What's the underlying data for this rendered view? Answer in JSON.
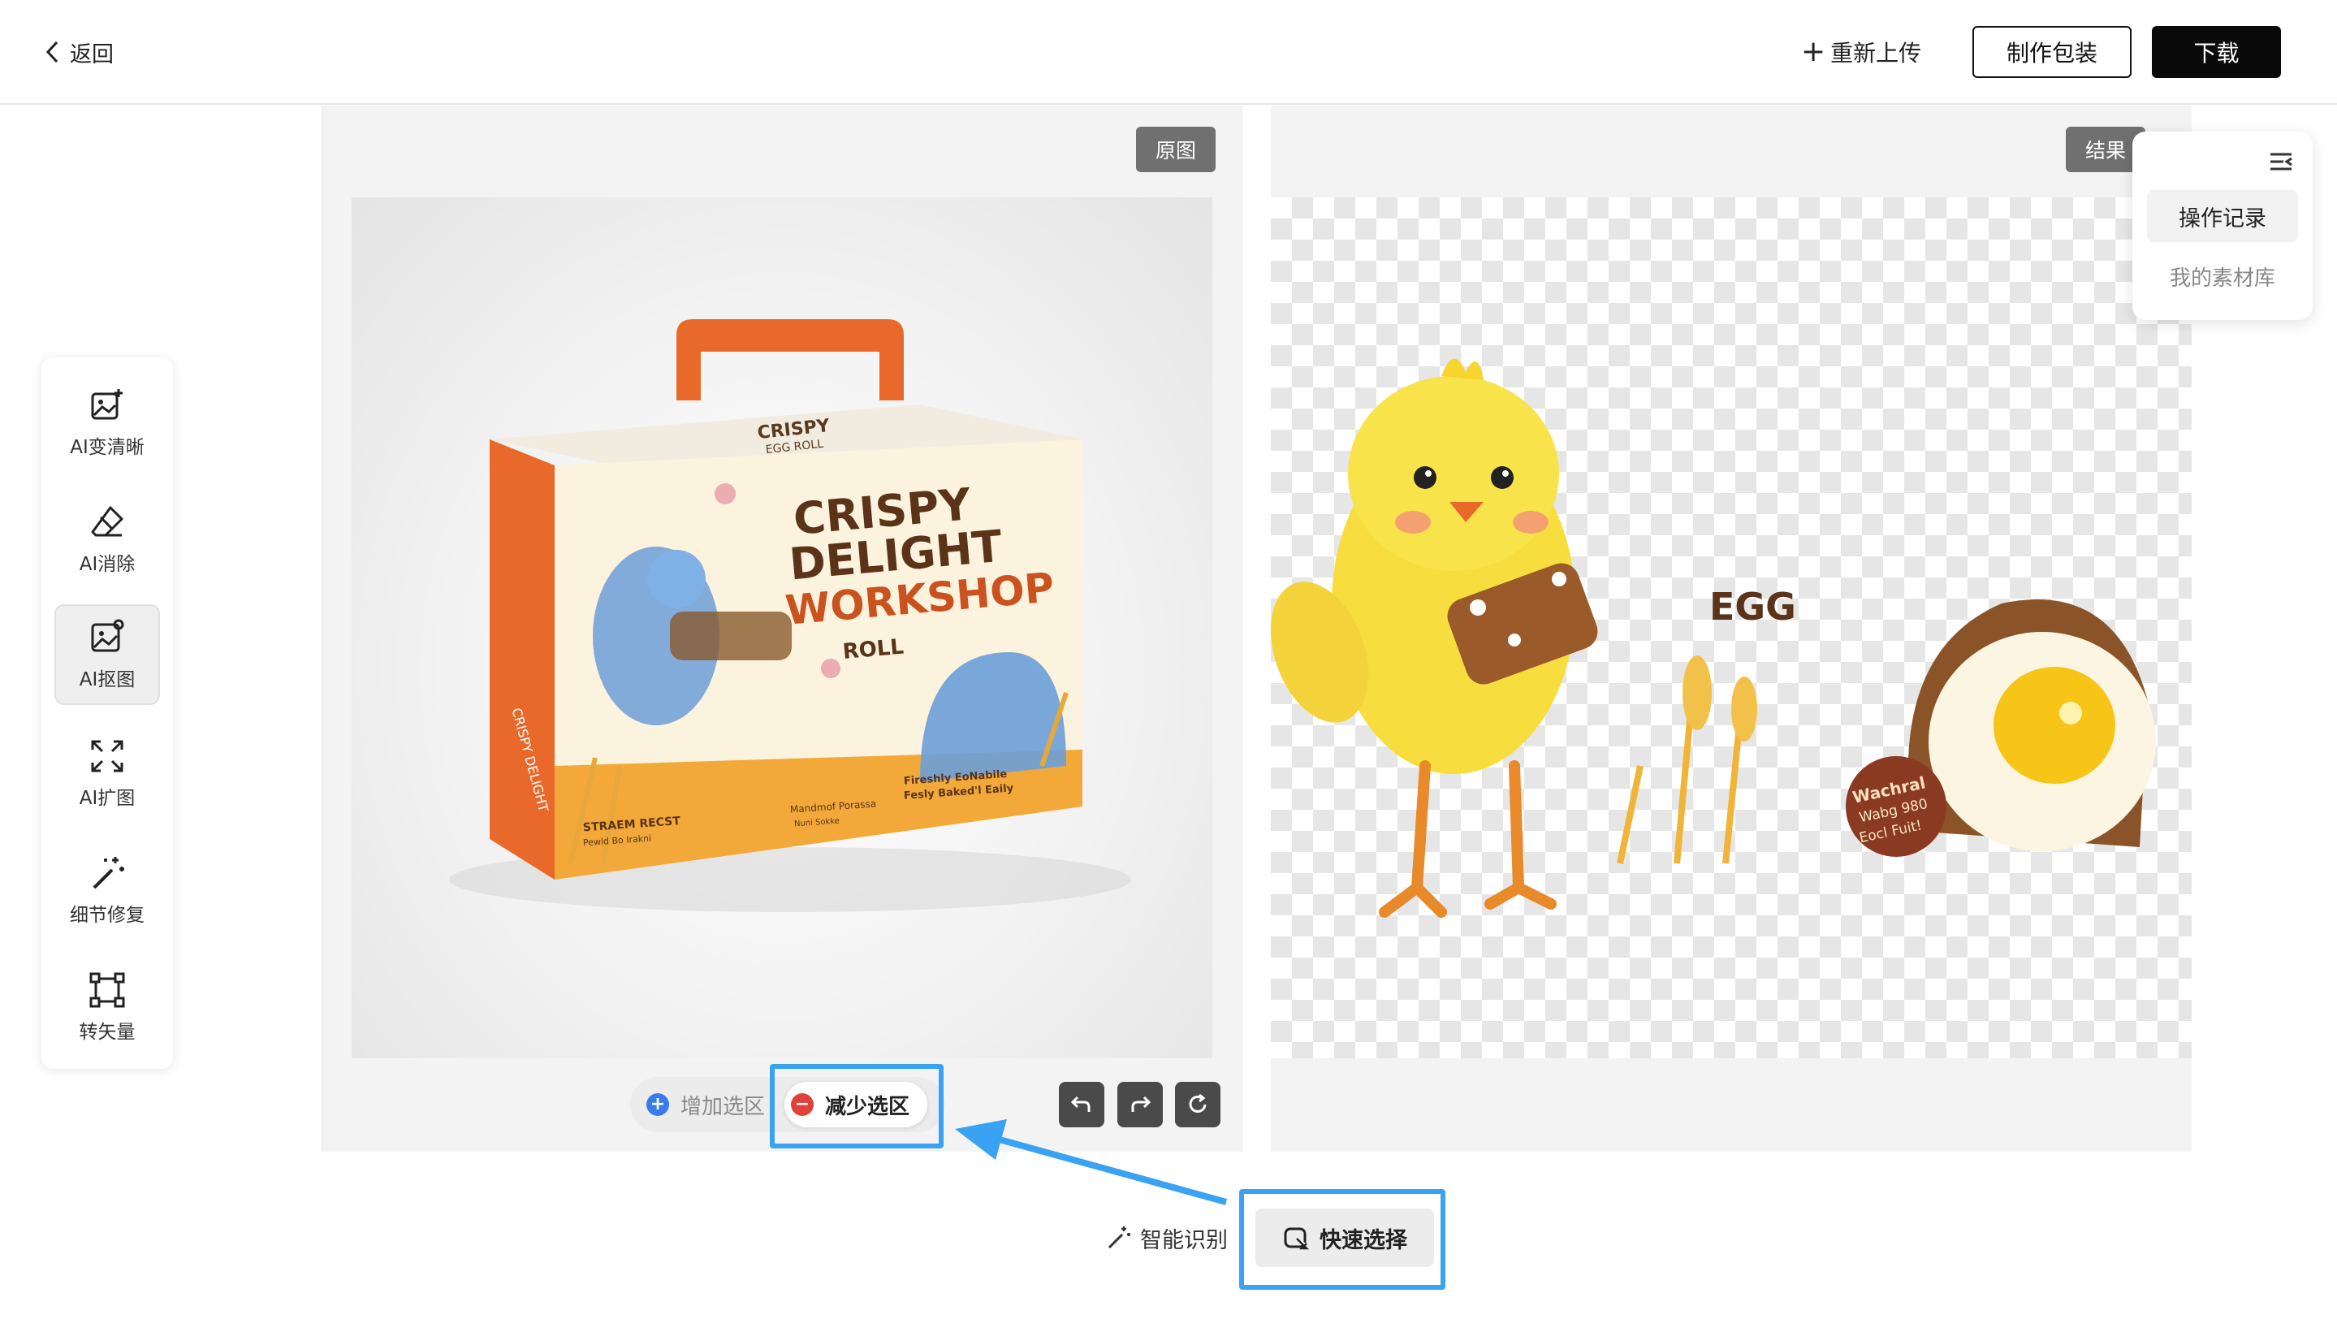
{
  "header": {
    "back_label": "返回",
    "reupload_label": "重新上传",
    "make_package_label": "制作包装",
    "download_label": "下载"
  },
  "toolbar": {
    "items": [
      {
        "label": "AI变清晰",
        "icon": "image-plus-icon"
      },
      {
        "label": "AI消除",
        "icon": "eraser-icon"
      },
      {
        "label": "AI抠图",
        "icon": "image-cutout-icon",
        "active": true
      },
      {
        "label": "AI扩图",
        "icon": "expand-icon"
      },
      {
        "label": "细节修复",
        "icon": "magic-wand-icon"
      },
      {
        "label": "转矢量",
        "icon": "vector-icon"
      }
    ]
  },
  "canvas": {
    "original_tag": "原图",
    "result_tag": "结果",
    "box_text": {
      "title_line1": "CRISPY",
      "title_line2": "DELIGHT",
      "title_line3": "WORKSHOP",
      "roll": "ROLL",
      "brand_left": "STRAEM RECST",
      "brand_left_sub": "Pewld Bo Irakni",
      "info_mid": "Mandmof Porassa",
      "info_mid_sub": "Nuni Sokke",
      "info_right": "Fireshly EoNabile",
      "info_right_sub": "Fesly Baked'l Eaily",
      "side_text": "CRISPY DELIGHT",
      "lid_text": "CRISPY",
      "lid_sub": "EGG ROLL"
    },
    "result_text": {
      "egg_text": "EGG",
      "badge_line1": "Wachral",
      "badge_line2": "Wabg 980",
      "badge_line3": "Eocl Fuit!"
    }
  },
  "selection": {
    "add_label": "增加选区",
    "subtract_label": "减少选区",
    "active": "subtract"
  },
  "controls": {
    "undo_icon": "undo-icon",
    "redo_icon": "redo-icon",
    "reset_icon": "refresh-icon"
  },
  "modes": {
    "smart_label": "智能识别",
    "quick_label": "快速选择",
    "active": "quick"
  },
  "history_popup": {
    "records_label": "操作记录",
    "library_label": "我的素材库"
  },
  "colors": {
    "highlight": "#3aa2f2",
    "accent_orange": "#e8692a",
    "primary_dark": "#0a0a0a",
    "add_blue": "#3b7be8",
    "subtract_red": "#e0413a"
  }
}
